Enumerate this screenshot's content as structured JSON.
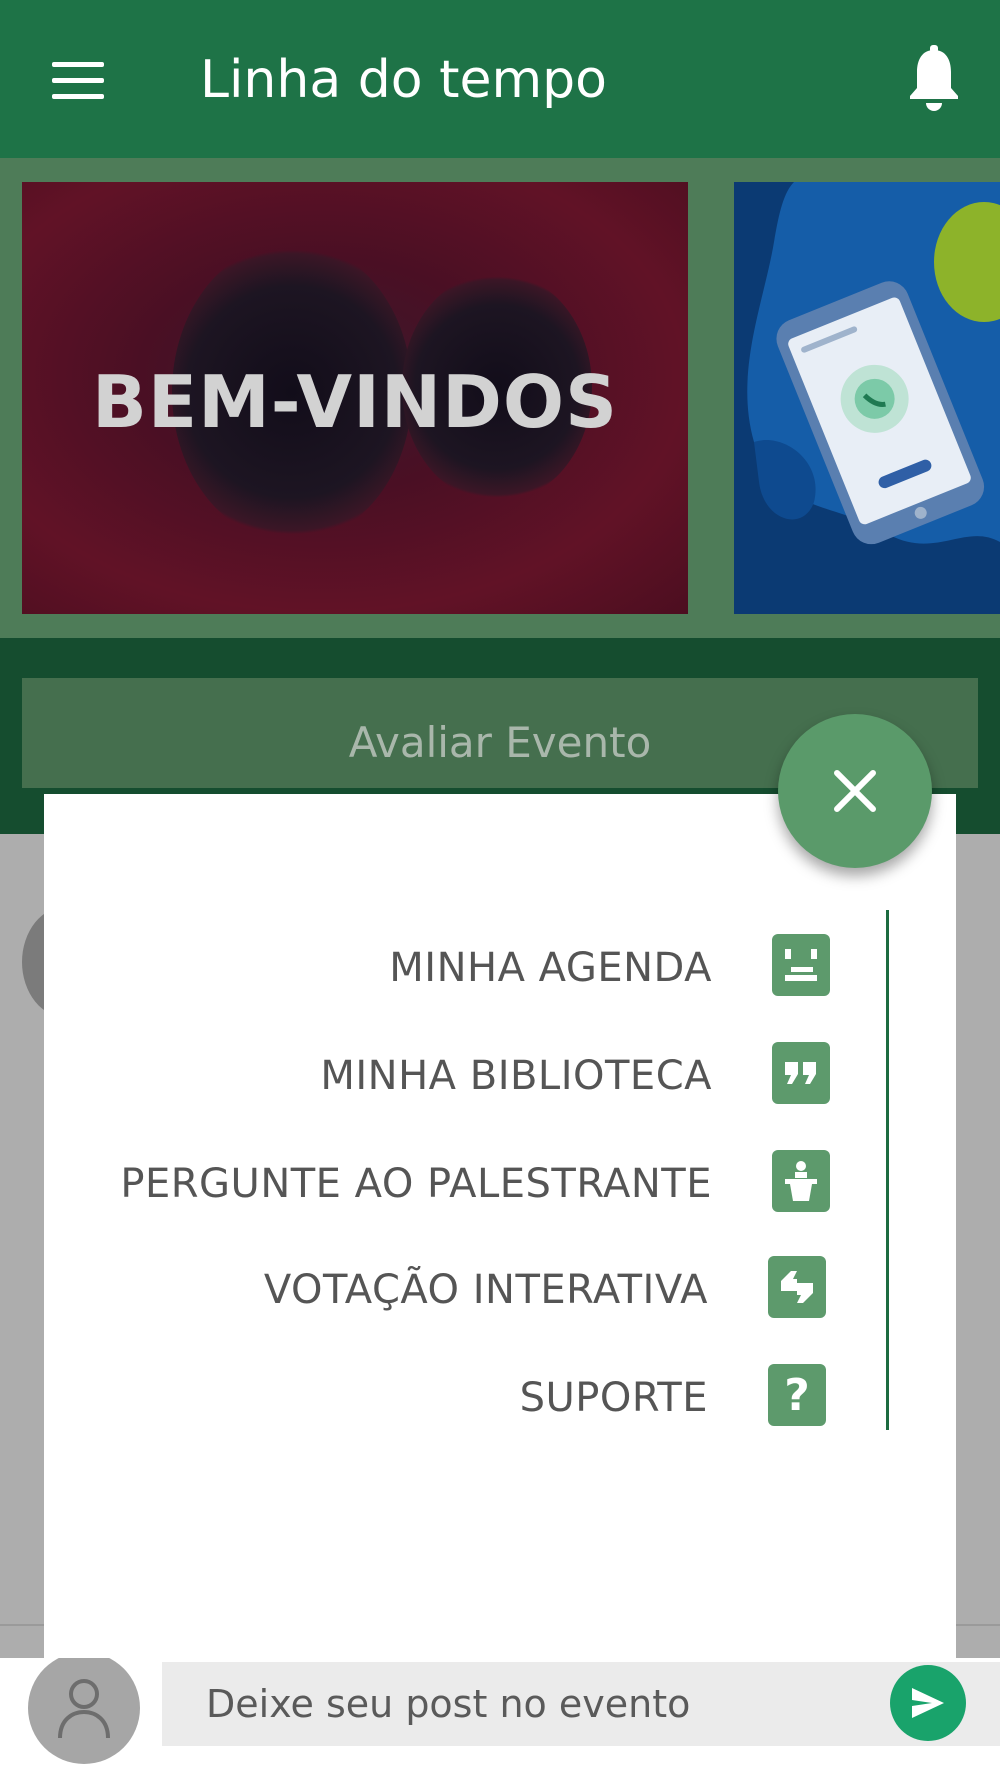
{
  "app_bar": {
    "title": "Linha do tempo",
    "menu_icon": "hamburger-menu-icon",
    "notification_icon": "bell-icon",
    "color": "#1e7347"
  },
  "carousel": {
    "slides": [
      {
        "text": "BEM-VINDOS"
      },
      {
        "icon": "phone-call-illustration"
      }
    ]
  },
  "rating_button": {
    "label": "Avaliar Evento"
  },
  "quick_menu": {
    "close_icon": "close-icon",
    "items": [
      {
        "label": "MINHA AGENDA",
        "icon": "agenda-icon"
      },
      {
        "label": "MINHA BIBLIOTECA",
        "icon": "quote-icon"
      },
      {
        "label": "PERGUNTE AO PALESTRANTE",
        "icon": "speaker-podium-icon"
      },
      {
        "label": "VOTAÇÃO INTERATIVA",
        "icon": "quote-pair-icon"
      },
      {
        "label": "SUPORTE",
        "icon": "question-icon",
        "glyph": "?"
      }
    ],
    "accent": "#5d9a6c"
  },
  "composer": {
    "placeholder": "Deixe seu post no evento",
    "avatar_icon": "user-icon",
    "send_icon": "send-icon",
    "send_color": "#19a36b"
  }
}
